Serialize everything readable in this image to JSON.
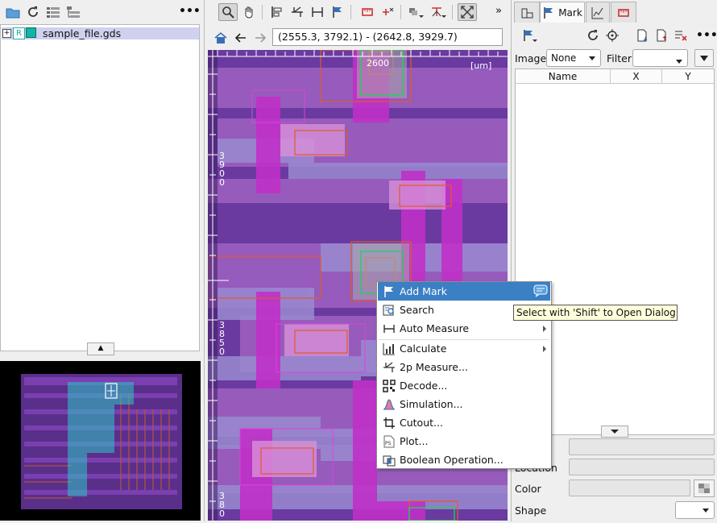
{
  "left_toolbar": {
    "icons": [
      "folder-open-icon",
      "refresh-icon",
      "cell-list-icon",
      "cell-tree-icon"
    ],
    "more": "•••"
  },
  "tree": {
    "items": [
      {
        "label": "sample_file.gds",
        "expander": "+",
        "badge": "R",
        "color": "#13b3a5"
      }
    ]
  },
  "collapse_handle": "▲",
  "view_toolbar": {
    "tools": [
      "zoom-icon",
      "pan-icon",
      "align-left-icon",
      "measure-icon",
      "width-icon",
      "flag-icon",
      "ruler-icon",
      "ruler-remove-icon",
      "layer-dropdown-icon",
      "snap-dropdown-icon",
      "fit-screen-icon"
    ],
    "overflow": "»"
  },
  "nav": {
    "coordinates": "(2555.3, 3792.1) - (2642.8, 3929.7)"
  },
  "canvas": {
    "unit": "[um]",
    "top_tick": "2600",
    "left_ticks": [
      "3900",
      "3850",
      "380"
    ]
  },
  "right_tabs": {
    "tabs": [
      "cells-tab",
      "Mark",
      "chart-tab",
      "measure-tab"
    ],
    "active": "Mark"
  },
  "mark_panel": {
    "image_label": "Image",
    "image_value": "None",
    "filter_label": "Filter",
    "filter_value": "",
    "columns": [
      "Name",
      "X",
      "Y"
    ],
    "rows": [],
    "location_label": "Location",
    "color_label": "Color",
    "shape_label": "Shape",
    "more": "•••"
  },
  "context_menu": {
    "items": [
      {
        "label": "Add Mark",
        "icon": "flag-icon",
        "highlighted": true,
        "submenu": false,
        "trail": "comment-icon"
      },
      {
        "label": "Search",
        "icon": "search-icon",
        "highlighted": false,
        "submenu": false
      },
      {
        "label": "Auto Measure",
        "icon": "measure-icon",
        "highlighted": false,
        "submenu": true
      },
      {
        "label": "Calculate",
        "icon": "chart-icon",
        "highlighted": false,
        "submenu": true
      },
      {
        "label": "2p Measure...",
        "icon": "two-point-icon",
        "highlighted": false,
        "submenu": false
      },
      {
        "label": "Decode...",
        "icon": "qr-code-icon",
        "highlighted": false,
        "submenu": false
      },
      {
        "label": "Simulation...",
        "icon": "simulation-icon",
        "highlighted": false,
        "submenu": false
      },
      {
        "label": "Cutout...",
        "icon": "crop-icon",
        "highlighted": false,
        "submenu": false
      },
      {
        "label": "Plot...",
        "icon": "ps-file-icon",
        "highlighted": false,
        "submenu": false
      },
      {
        "label": "Boolean Operation...",
        "icon": "boolean-icon",
        "highlighted": false,
        "submenu": false
      }
    ]
  },
  "tooltip": "Select with 'Shift' to Open Dialog",
  "colors": {
    "selection": "#cfd1ef",
    "menu_highlight": "#3b7fc4",
    "layout_bg": "#6a3aa0",
    "tooltip_bg": "#ffffdc"
  }
}
